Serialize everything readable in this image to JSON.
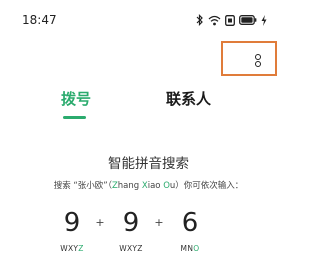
{
  "status_bar": {
    "time": "18:47",
    "icons": [
      "bluetooth-icon",
      "wifi-icon",
      "sim-icon",
      "battery-icon",
      "charging-icon"
    ]
  },
  "menu": {
    "icon": "more-vertical-icon"
  },
  "tabs": [
    {
      "label": "拨号",
      "active": true
    },
    {
      "label": "联系人",
      "active": false
    }
  ],
  "smart_search": {
    "title": "智能拼音搜索",
    "hint_parts": [
      "搜索 “张小欧”（",
      "Z",
      "hang ",
      "X",
      "iao ",
      "O",
      "u）你可依次输入："
    ]
  },
  "keys": [
    {
      "number": "9",
      "letters_plain": "WXY",
      "letters_highlight": "Z"
    },
    {
      "number": "9",
      "letters_plain": "WXYZ",
      "letters_highlight": ""
    },
    {
      "number": "6",
      "letters_plain": "MN",
      "letters_highlight": "O"
    }
  ],
  "separator": "+",
  "colors": {
    "accent": "#2bab6e",
    "highlight_box": "#e07c3a"
  }
}
